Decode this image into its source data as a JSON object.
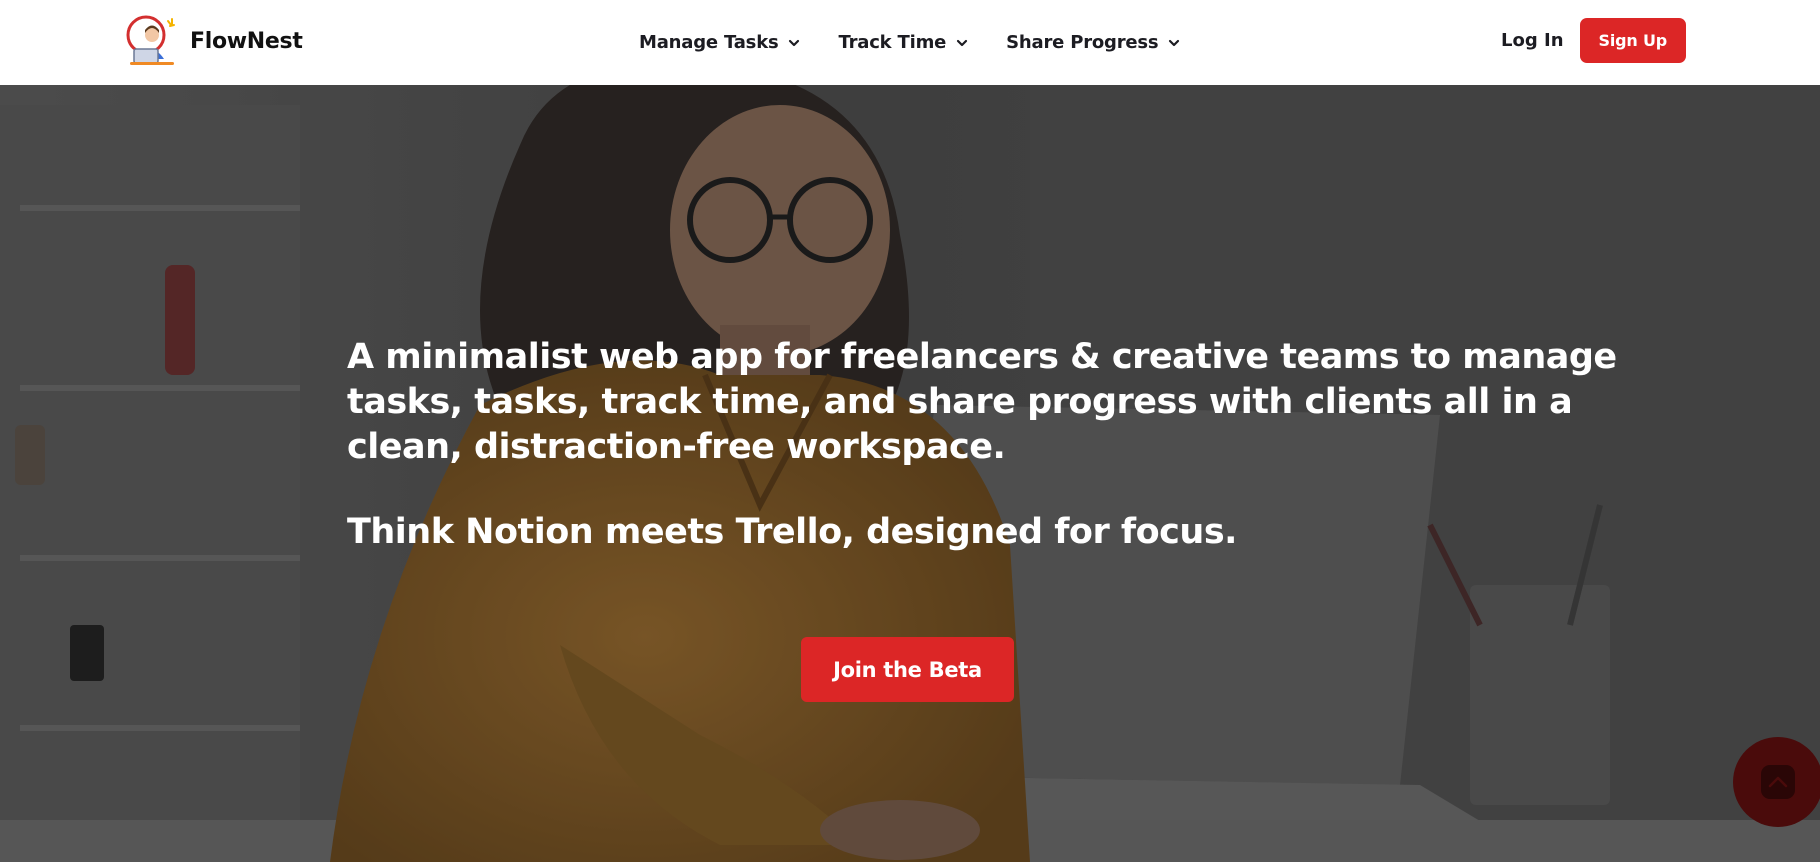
{
  "header": {
    "brand_name": "FlowNest",
    "logo_icon": "freelancer-at-laptop-logo-icon",
    "nav": [
      {
        "label": "Manage Tasks",
        "icon": "chevron-down-icon"
      },
      {
        "label": "Track Time",
        "icon": "chevron-down-icon"
      },
      {
        "label": "Share Progress",
        "icon": "chevron-down-icon"
      }
    ],
    "login_label": "Log In",
    "signup_label": "Sign Up"
  },
  "hero": {
    "tagline": "A minimalist web app for freelancers & creative teams to manage tasks, tasks, track time, and share progress with clients all in a clean, distraction-free workspace.",
    "subtag": "Think Notion meets Trello, designed for focus.",
    "cta_label": "Join the Beta",
    "background_icon": "woman-working-at-laptop-photo",
    "scroll_top_icon": "chevron-up-icon"
  },
  "colors": {
    "accent": "#dc2626",
    "header_bg": "#ffffff",
    "nav_text": "#1c1c22",
    "hero_overlay": "#3a3a3a",
    "hero_text": "#ffffff",
    "scroll_button": "#4a0b0b"
  }
}
